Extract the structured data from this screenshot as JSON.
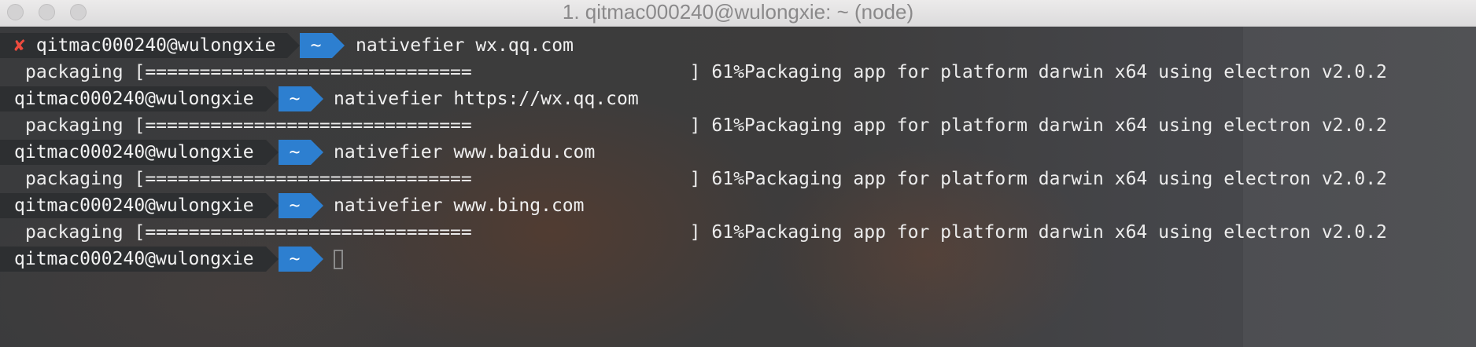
{
  "window": {
    "title": "1. qitmac000240@wulongxie: ~ (node)"
  },
  "terminal": {
    "prompts": [
      {
        "status_icon": "✘",
        "user_host": "qitmac000240@wulongxie",
        "dir": "~",
        "command": "nativefier wx.qq.com"
      },
      {
        "status_icon": "",
        "user_host": "qitmac000240@wulongxie",
        "dir": "~",
        "command": "nativefier https://wx.qq.com"
      },
      {
        "status_icon": "",
        "user_host": "qitmac000240@wulongxie",
        "dir": "~",
        "command": "nativefier www.baidu.com"
      },
      {
        "status_icon": "",
        "user_host": "qitmac000240@wulongxie",
        "dir": "~",
        "command": "nativefier www.bing.com"
      },
      {
        "status_icon": "",
        "user_host": "qitmac000240@wulongxie",
        "dir": "~",
        "command": ""
      }
    ],
    "outputs": [
      "packaging [==============================                    ] 61%Packaging app for platform darwin x64 using electron v2.0.2",
      "packaging [==============================                    ] 61%Packaging app for platform darwin x64 using electron v2.0.2",
      "packaging [==============================                    ] 61%Packaging app for platform darwin x64 using electron v2.0.2",
      "packaging [==============================                    ] 61%Packaging app for platform darwin x64 using electron v2.0.2"
    ],
    "progress_percent": 61
  },
  "colors": {
    "error_icon": "#ee4b3e",
    "dir_segment": "#2d7fd0",
    "user_segment": "#2d2f31"
  }
}
